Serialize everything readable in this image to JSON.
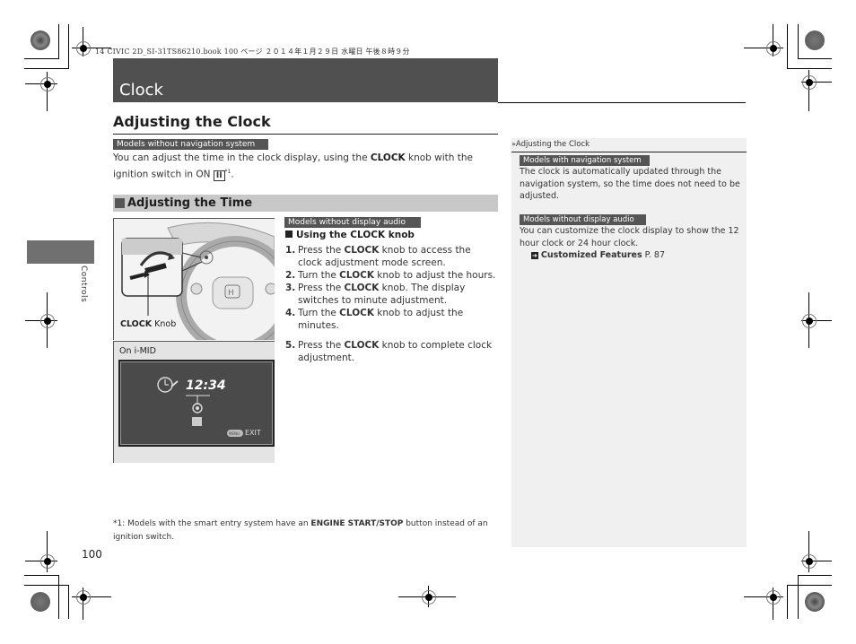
{
  "print_header": "14 CIVIC 2D_SI-31TS86210.book   100 ページ   ２０１４年１月２９日   水曜日   午後８時９分",
  "chapter_title": "Clock",
  "section_title": "Adjusting the Clock",
  "intro": {
    "tag": "Models without navigation system",
    "text_before": "You can adjust the time in the clock display, using the ",
    "text_bold": "CLOCK",
    "text_after": " knob with the ignition switch in ON ",
    "switch_symbol": "II",
    "footnote_ref": "*1",
    "period": "."
  },
  "subsection": {
    "title": "Adjusting the Time",
    "tag": "Models without display audio",
    "procedure_title": "Using the CLOCK knob",
    "steps": [
      {
        "num": "1.",
        "pre": "Press the ",
        "bold": "CLOCK",
        "post": " knob to access the clock adjustment mode screen."
      },
      {
        "num": "2.",
        "pre": "Turn the ",
        "bold": "CLOCK",
        "post": " knob to adjust the hours."
      },
      {
        "num": "3.",
        "pre": "Press the ",
        "bold": "CLOCK",
        "post": " knob. The display switches to minute adjustment."
      },
      {
        "num": "4.",
        "pre": "Turn the ",
        "bold": "CLOCK",
        "post": " knob to adjust the minutes."
      },
      {
        "num": "5.",
        "pre": "Press the ",
        "bold": "CLOCK",
        "post": " knob to complete clock adjustment."
      }
    ]
  },
  "figure_knob": {
    "label_bold": "CLOCK",
    "label_rest": " Knob"
  },
  "figure_imid": {
    "caption": "On i-MID",
    "time": "12:34",
    "menu_label": "MENU",
    "exit_label": "EXIT"
  },
  "footnote": {
    "pre": "*1: Models with the smart entry system have an ",
    "bold": "ENGINE START/STOP",
    "post": " button instead of an ignition switch."
  },
  "sidebar": {
    "heading_icon": "double-chevron",
    "heading": "Adjusting the Clock",
    "blocks": [
      {
        "tag": "Models with navigation system",
        "text": "The clock is automatically updated through the navigation system, so the time does not need to be adjusted."
      },
      {
        "tag": "Models without display audio",
        "text": "You can customize the clock display to show the 12 hour clock or 24 hour clock.",
        "link_bold": "Customized Features",
        "link_page": " P. 87"
      }
    ]
  },
  "side_tab": "Controls",
  "page_number": "100"
}
